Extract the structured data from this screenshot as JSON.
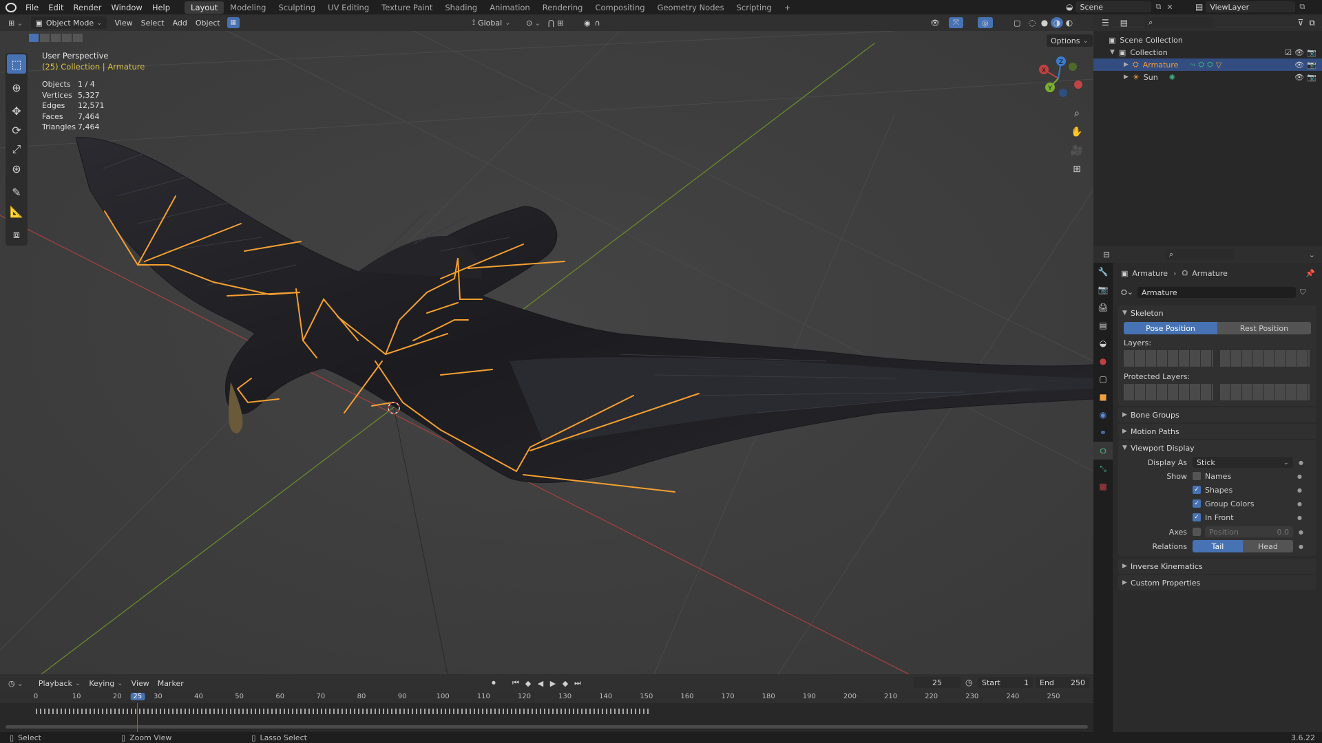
{
  "menu": {
    "items": [
      "File",
      "Edit",
      "Render",
      "Window",
      "Help"
    ]
  },
  "workspaces": {
    "tabs": [
      "Layout",
      "Modeling",
      "Sculpting",
      "UV Editing",
      "Texture Paint",
      "Shading",
      "Animation",
      "Rendering",
      "Compositing",
      "Geometry Nodes",
      "Scripting"
    ],
    "active": "Layout",
    "add": "+"
  },
  "scene": {
    "label": "Scene",
    "viewlayer": "ViewLayer"
  },
  "viewport_header": {
    "mode": "Object Mode",
    "menus": [
      "View",
      "Select",
      "Add",
      "Object"
    ],
    "orientation": "Global",
    "options": "Options"
  },
  "overlay": {
    "perspective": "User Perspective",
    "collection": "(25) Collection | Armature",
    "stats": [
      {
        "k": "Objects",
        "v": "1 / 4"
      },
      {
        "k": "Vertices",
        "v": "5,327"
      },
      {
        "k": "Edges",
        "v": "12,571"
      },
      {
        "k": "Faces",
        "v": "7,464"
      },
      {
        "k": "Triangles",
        "v": "7,464"
      }
    ]
  },
  "gizmo": {
    "x": "X",
    "y": "Y",
    "z": "Z"
  },
  "timeline": {
    "menus": [
      "Playback",
      "Keying",
      "View",
      "Marker"
    ],
    "current_frame": "25",
    "start_label": "Start",
    "start": "1",
    "end_label": "End",
    "end": "250",
    "ticks": [
      "0",
      "10",
      "20",
      "25",
      "30",
      "40",
      "50",
      "60",
      "70",
      "80",
      "90",
      "100",
      "110",
      "120",
      "130",
      "140",
      "150",
      "160",
      "170",
      "180",
      "190",
      "200",
      "210",
      "220",
      "230",
      "240",
      "250"
    ]
  },
  "statusbar": {
    "select": "Select",
    "zoom": "Zoom View",
    "lasso": "Lasso Select",
    "version": "3.6.22"
  },
  "outliner": {
    "root": "Scene Collection",
    "collection": "Collection",
    "items": [
      "Armature",
      "Sun"
    ]
  },
  "properties": {
    "breadcrumb": [
      "Armature",
      "Armature"
    ],
    "data_name": "Armature",
    "skeleton": {
      "title": "Skeleton",
      "pose": "Pose Position",
      "rest": "Rest Position",
      "layers": "Layers:",
      "protected": "Protected Layers:"
    },
    "sections": [
      "Bone Groups",
      "Motion Paths"
    ],
    "viewport_display": {
      "title": "Viewport Display",
      "display_as_label": "Display As",
      "display_as": "Stick",
      "show_label": "Show",
      "checks": [
        {
          "label": "Names",
          "on": false
        },
        {
          "label": "Shapes",
          "on": true
        },
        {
          "label": "Group Colors",
          "on": true
        },
        {
          "label": "In Front",
          "on": true
        }
      ],
      "axes_label": "Axes",
      "position_label": "Position",
      "position_value": "0.0",
      "relations_label": "Relations",
      "tail": "Tail",
      "head": "Head"
    },
    "closed": [
      "Inverse Kinematics",
      "Custom Properties"
    ]
  },
  "colors": {
    "accent": "#4772b3",
    "bone": "#f5a030",
    "selected_text": "#f0a040",
    "overlay_yellow": "#d9c040"
  }
}
